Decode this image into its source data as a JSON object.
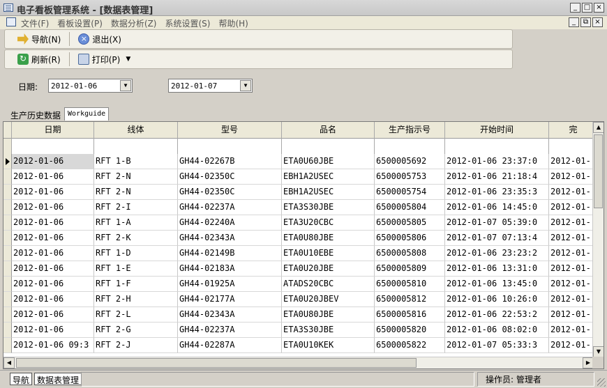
{
  "window": {
    "title": "电子看板管理系统 - [数据表管理]",
    "buttons": [
      "_",
      "□",
      "×"
    ]
  },
  "menu": {
    "items": [
      "文件(F)",
      "看板设置(P)",
      "数据分析(Z)",
      "系统设置(S)",
      "帮助(H)"
    ],
    "mdi_buttons": [
      "_",
      "⧉",
      "×"
    ]
  },
  "toolbar1": {
    "nav_label": "导航(N)",
    "exit_label": "退出(X)"
  },
  "toolbar2": {
    "refresh_label": "刷新(R)",
    "print_label": "打印(P)"
  },
  "filter": {
    "label": "日期:",
    "date_from": "2012-01-06",
    "date_to": "2012-01-07"
  },
  "tabs": [
    "生产历史数据",
    "Workguide"
  ],
  "table": {
    "headers": [
      "日期",
      "线体",
      "型号",
      "品名",
      "生产指示号",
      "开始时间",
      "完"
    ],
    "rows": [
      [
        "2012-01-06",
        "RFT 1-B",
        "GH44-02267B",
        "ETA0U60JBE",
        "6500005692",
        "2012-01-06 23:37:0",
        "2012-01-"
      ],
      [
        "2012-01-06",
        "RFT 2-N",
        "GH44-02350C",
        "EBH1A2USEC",
        "6500005753",
        "2012-01-06 21:18:4",
        "2012-01-"
      ],
      [
        "2012-01-06",
        "RFT 2-N",
        "GH44-02350C",
        "EBH1A2USEC",
        "6500005754",
        "2012-01-06 23:35:3",
        "2012-01-"
      ],
      [
        "2012-01-06",
        "RFT 2-I",
        "GH44-02237A",
        "ETA3S30JBE",
        "6500005804",
        "2012-01-06 14:45:0",
        "2012-01-"
      ],
      [
        "2012-01-06",
        "RFT 1-A",
        "GH44-02240A",
        "ETA3U20CBC",
        "6500005805",
        "2012-01-07 05:39:0",
        "2012-01-"
      ],
      [
        "2012-01-06",
        "RFT 2-K",
        "GH44-02343A",
        "ETA0U80JBE",
        "6500005806",
        "2012-01-07 07:13:4",
        "2012-01-"
      ],
      [
        "2012-01-06",
        "RFT 1-D",
        "GH44-02149B",
        "ETA0U10EBE",
        "6500005808",
        "2012-01-06 23:23:2",
        "2012-01-"
      ],
      [
        "2012-01-06",
        "RFT 1-E",
        "GH44-02183A",
        "ETA0U20JBE",
        "6500005809",
        "2012-01-06 13:31:0",
        "2012-01-"
      ],
      [
        "2012-01-06",
        "RFT 1-F",
        "GH44-01925A",
        "ATADS20CBC",
        "6500005810",
        "2012-01-06 13:45:0",
        "2012-01-"
      ],
      [
        "2012-01-06",
        "RFT 2-H",
        "GH44-02177A",
        "ETA0U20JBEV",
        "6500005812",
        "2012-01-06 10:26:0",
        "2012-01-"
      ],
      [
        "2012-01-06",
        "RFT 2-L",
        "GH44-02343A",
        "ETA0U80JBE",
        "6500005816",
        "2012-01-06 22:53:2",
        "2012-01-"
      ],
      [
        "2012-01-06",
        "RFT 2-G",
        "GH44-02237A",
        "ETA3S30JBE",
        "6500005820",
        "2012-01-06 08:02:0",
        "2012-01-"
      ],
      [
        "2012-01-06 09:3",
        "RFT 2-J",
        "GH44-02287A",
        "ETA0U10KEK",
        "6500005822",
        "2012-01-07 05:33:3",
        "2012-01-"
      ]
    ]
  },
  "statusbar": {
    "tabs": [
      "导航",
      "数据表管理"
    ],
    "operator_label": "操作员:",
    "operator_name": "管理者"
  }
}
